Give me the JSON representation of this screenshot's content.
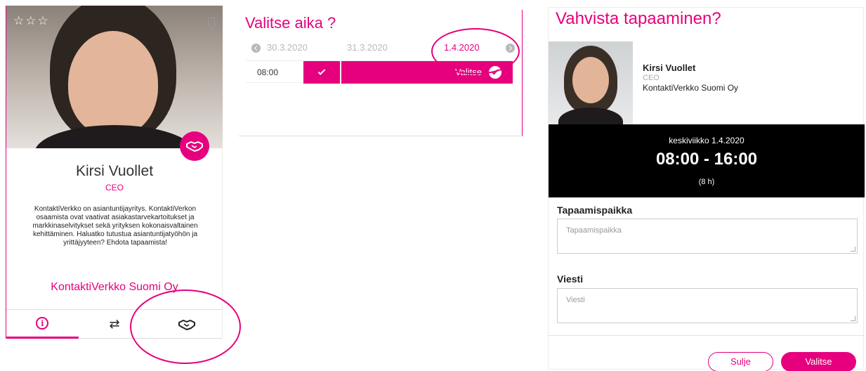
{
  "profile_card": {
    "rating_stars": "☆☆☆",
    "name": "Kirsi Vuollet",
    "title": "CEO",
    "description": "KontaktiVerkko on asiantuntijayritys. KontaktiVerkon osaamista ovat vaativat asiakastarvekartoitukset ja markkinaselvitykset sekä yrityksen kokonaisvaltainen kehittäminen. Haluatko tutustua asiantuntijatyöhön ja yrittäjyyteen? Ehdota tapaamista!",
    "company": "KontaktiVerkko Suomi Oy",
    "tabs": [
      {
        "icon": "info-icon",
        "active": true
      },
      {
        "icon": "swap-icon",
        "label": "⇄"
      },
      {
        "icon": "handshake-icon"
      }
    ]
  },
  "time_picker": {
    "title": "Valitse aika ?",
    "dates": [
      "30.3.2020",
      "31.3.2020",
      "1.4.2020"
    ],
    "selected_date": "1.4.2020",
    "slots": [
      {
        "time": "08:00",
        "action_label": "Valitse"
      }
    ]
  },
  "confirm_dialog": {
    "title": "Vahvista tapaaminen?",
    "person": {
      "name": "Kirsi Vuollet",
      "title": "CEO",
      "company": "KontaktiVerkko Suomi Oy"
    },
    "meeting": {
      "date": "keskiviikko 1.4.2020",
      "time": "08:00 - 16:00",
      "duration": "(8 h)"
    },
    "location": {
      "label": "Tapaamispaikka",
      "placeholder": "Tapaamispaikka",
      "value": ""
    },
    "message": {
      "label": "Viesti",
      "placeholder": "Viesti",
      "value": ""
    },
    "buttons": {
      "cancel": "Sulje",
      "confirm": "Valitse"
    }
  },
  "colors": {
    "accent": "#e6007e",
    "black": "#000000"
  }
}
